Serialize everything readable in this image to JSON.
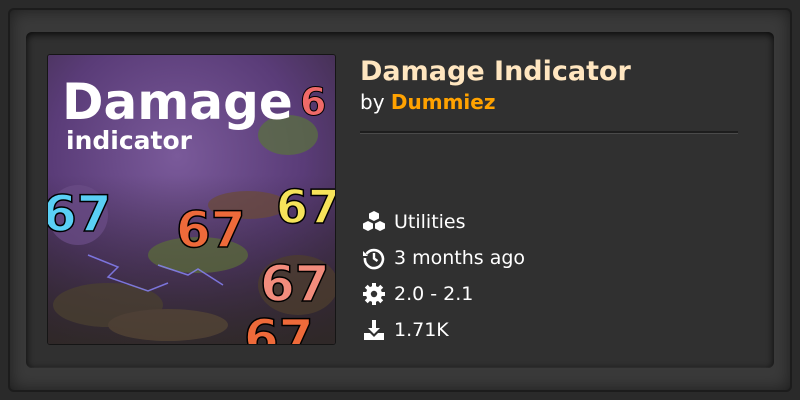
{
  "mod": {
    "title": "Damage Indicator",
    "by_label": "by",
    "author": "Dummiez",
    "category": "Utilities",
    "updated": "3 months ago",
    "version": "2.0 - 2.1",
    "downloads": "1.71K"
  },
  "thumbnail": {
    "title_line1": "Damage",
    "title_line2": "indicator",
    "numbers": [
      "67",
      "67",
      "67",
      "67",
      "67",
      "6"
    ]
  },
  "colors": {
    "page_bg": "#2a2a2a",
    "card_bg": "#303030",
    "title": "#ffe6c0",
    "author": "#ffa200",
    "num_blue": "#5ad0f5",
    "num_orange": "#ee6a3a",
    "num_yellow": "#f6e35a",
    "num_salmon": "#f28c7c"
  },
  "icons": {
    "category": "cubes-icon",
    "updated": "history-icon",
    "version": "gear-icon",
    "downloads": "download-icon"
  }
}
